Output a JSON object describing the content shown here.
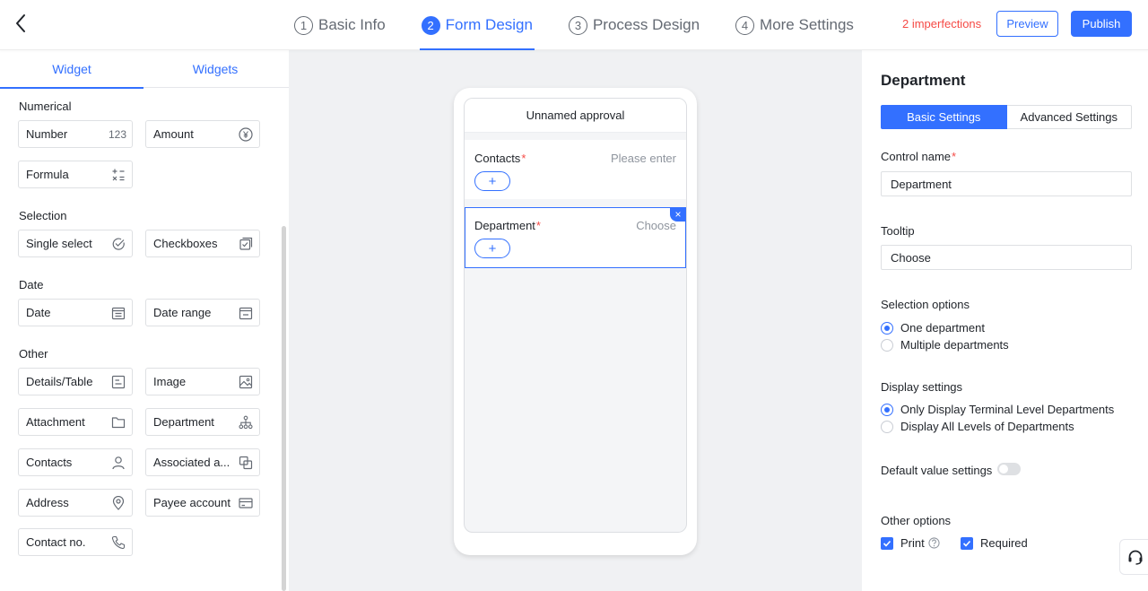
{
  "header": {
    "steps": [
      {
        "num": "1",
        "label": "Basic Info"
      },
      {
        "num": "2",
        "label": "Form Design"
      },
      {
        "num": "3",
        "label": "Process Design"
      },
      {
        "num": "4",
        "label": "More Settings"
      }
    ],
    "imperfections": "2 imperfections",
    "preview_label": "Preview",
    "publish_label": "Publish"
  },
  "left": {
    "tabs": [
      "Widget",
      "Widgets"
    ],
    "groups": {
      "numerical": "Numerical",
      "selection": "Selection",
      "date": "Date",
      "other": "Other"
    },
    "widgets": {
      "number": {
        "label": "Number",
        "icon_text": "123"
      },
      "amount": "Amount",
      "formula": "Formula",
      "single_select": "Single select",
      "checkboxes": "Checkboxes",
      "date": "Date",
      "date_range": "Date range",
      "details_table": "Details/Table",
      "image": "Image",
      "attachment": "Attachment",
      "department": "Department",
      "contacts": "Contacts",
      "associated": "Associated a...",
      "address": "Address",
      "payee_account": "Payee account",
      "contact_no": "Contact no."
    }
  },
  "preview": {
    "title": "Unnamed approval",
    "fields": [
      {
        "label": "Contacts",
        "placeholder": "Please enter",
        "add": "+"
      },
      {
        "label": "Department",
        "placeholder": "Choose",
        "add": "+"
      }
    ],
    "delete_icon": "×",
    "required_mark": "*"
  },
  "settings": {
    "title": "Department",
    "tabs": [
      "Basic Settings",
      "Advanced Settings"
    ],
    "control_name_label": "Control name",
    "control_name_value": "Department",
    "tooltip_label": "Tooltip",
    "tooltip_value": "Choose",
    "selection_options_label": "Selection options",
    "selection_options": [
      "One department",
      "Multiple departments"
    ],
    "display_settings_label": "Display settings",
    "display_settings": [
      "Only Display Terminal Level Departments",
      "Display All Levels of Departments"
    ],
    "default_value_label": "Default value settings",
    "other_options_label": "Other options",
    "other_options": [
      "Print",
      "Required"
    ],
    "required_mark": "*"
  },
  "colors": {
    "accent": "#3370ff",
    "danger": "#f54a45"
  }
}
